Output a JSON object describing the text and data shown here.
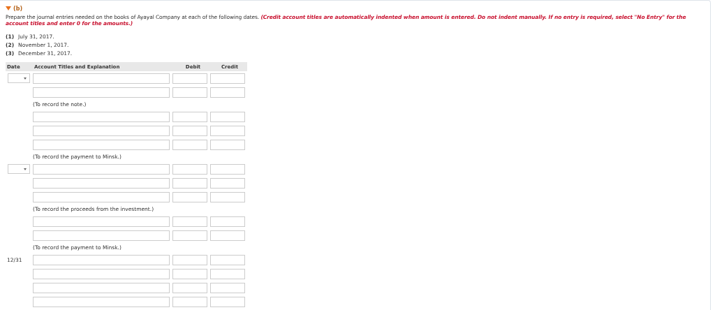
{
  "section": {
    "expanded": true,
    "label": "(b)"
  },
  "instructions": {
    "text": "Prepare the journal entries needed on the books of Ayayal Company at each of the following dates.",
    "note": "(Credit account titles are automatically indented when amount is entered. Do not indent manually. If no entry is required, select \"No Entry\" for the account titles and enter 0 for the amounts.)"
  },
  "dates": [
    {
      "number": "(1)",
      "text": "July 31, 2017."
    },
    {
      "number": "(2)",
      "text": "November 1, 2017."
    },
    {
      "number": "(3)",
      "text": "December 31, 2017."
    }
  ],
  "table": {
    "columns": [
      "Date",
      "Account Titles and Explanation",
      "Debit",
      "Credit"
    ],
    "groups": [
      {
        "rows": [
          {
            "kind": "select"
          },
          {
            "kind": "plain"
          }
        ],
        "note": "(To record the note.)"
      },
      {
        "rows": [
          {
            "kind": "plain"
          },
          {
            "kind": "plain"
          },
          {
            "kind": "plain"
          }
        ],
        "note": "(To record the payment to Minsk.)"
      },
      {
        "rows": [
          {
            "kind": "select"
          },
          {
            "kind": "plain"
          },
          {
            "kind": "plain"
          }
        ],
        "note": "(To record the proceeds from the investment.)"
      },
      {
        "rows": [
          {
            "kind": "plain"
          },
          {
            "kind": "plain"
          }
        ],
        "note": "(To record the payment to Minsk.)"
      },
      {
        "rows": [
          {
            "kind": "text",
            "date": "12/31"
          },
          {
            "kind": "plain"
          },
          {
            "kind": "plain"
          },
          {
            "kind": "plain"
          }
        ]
      }
    ]
  }
}
